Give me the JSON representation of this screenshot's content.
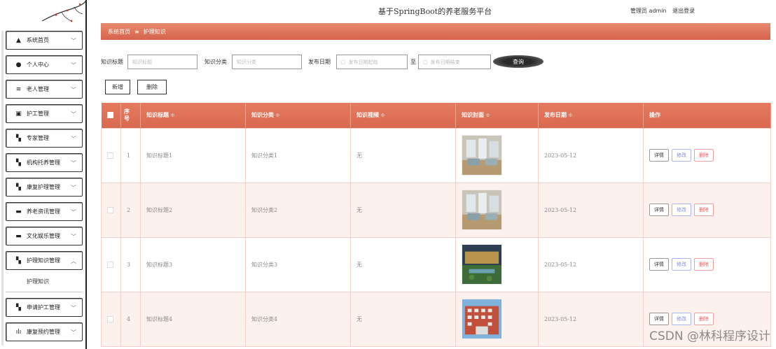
{
  "header": {
    "site_title": "基于SpringBoot的养老服务平台",
    "user_label": "管理员 admin",
    "logout_label": "退出登录"
  },
  "sidebar": {
    "items": [
      {
        "label": "系统首页",
        "icon": "home-icon",
        "glyph": "▲"
      },
      {
        "label": "个人中心",
        "icon": "person-icon",
        "glyph": "●"
      },
      {
        "label": "老人管理",
        "icon": "list-icon",
        "glyph": "≡"
      },
      {
        "label": "护工管理",
        "icon": "clipboard-icon",
        "glyph": "▣"
      },
      {
        "label": "专家管理",
        "icon": "grid-icon",
        "glyph": "▚"
      },
      {
        "label": "机构托养管理",
        "icon": "grid-icon",
        "glyph": "▚"
      },
      {
        "label": "康复护理管理",
        "icon": "grid-icon",
        "glyph": "▚"
      },
      {
        "label": "养老资讯管理",
        "icon": "monitor-icon",
        "glyph": "▬"
      },
      {
        "label": "文化娱乐管理",
        "icon": "monitor-icon",
        "glyph": "▬"
      },
      {
        "label": "护理知识管理",
        "icon": "grid-icon",
        "glyph": "▚"
      },
      {
        "label": "申请护工管理",
        "icon": "grid-icon",
        "glyph": "▚"
      },
      {
        "label": "康复预约管理",
        "icon": "bar-chart-icon",
        "glyph": "ılı"
      }
    ],
    "sub_item": "护理知识"
  },
  "breadcrumb": {
    "home": "系统首页",
    "separator": "≡",
    "current": "护理知识"
  },
  "search": {
    "title_label": "知识标题",
    "title_placeholder": "知识标题",
    "category_label": "知识分类",
    "category_placeholder": "知识分类",
    "date_label": "发布日期",
    "date_start_placeholder": "发布日期起始",
    "date_to": "至",
    "date_end_placeholder": "发布日期结束",
    "query_button": "查询"
  },
  "actions": {
    "add": "新增",
    "delete": "删除"
  },
  "table": {
    "columns": [
      "序号",
      "知识标题",
      "知识分类",
      "知识视频",
      "知识封面",
      "发布日期",
      "操作"
    ],
    "index_header_line1": "序",
    "index_header_line2": "号",
    "sort_glyph": "≑",
    "ops": {
      "detail": "详情",
      "edit": "修改",
      "delete": "删除"
    },
    "rows": [
      {
        "index": "1",
        "title": "知识标题1",
        "category": "知识分类1",
        "video": "无",
        "date": "2023-05-12",
        "cover": "room"
      },
      {
        "index": "2",
        "title": "知识标题2",
        "category": "知识分类2",
        "video": "无",
        "date": "2023-05-12",
        "cover": "room"
      },
      {
        "index": "3",
        "title": "知识标题3",
        "category": "知识分类3",
        "video": "无",
        "date": "2023-05-12",
        "cover": "garden"
      },
      {
        "index": "4",
        "title": "知识标题4",
        "category": "知识分类4",
        "video": "无",
        "date": "2023-05-12",
        "cover": "building"
      }
    ]
  },
  "watermark": "CSDN @林科程序设计",
  "colors": {
    "accent": "#d9694f",
    "accent_light": "#e88a70",
    "row_alt": "#fdf1ee"
  }
}
